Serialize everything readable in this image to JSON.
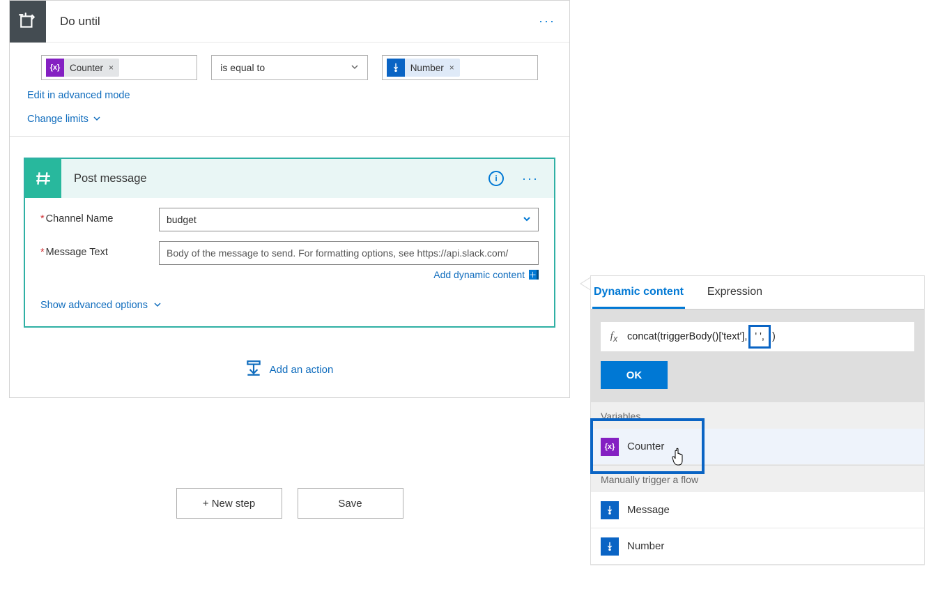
{
  "doUntil": {
    "title": "Do until",
    "leftToken": "Counter",
    "operator": "is equal to",
    "rightToken": "Number",
    "editAdvanced": "Edit in advanced mode",
    "changeLimits": "Change limits"
  },
  "postMessage": {
    "title": "Post message",
    "channelLabel": "Channel Name",
    "channelValue": "budget",
    "messageLabel": "Message Text",
    "messagePlaceholder": "Body of the message to send. For formatting options, see https://api.slack.com/",
    "addDynamic": "Add dynamic content",
    "showAdvanced": "Show advanced options"
  },
  "addAction": "Add an action",
  "footer": {
    "newStep": "+ New step",
    "save": "Save"
  },
  "dynPanel": {
    "tabDynamic": "Dynamic content",
    "tabExpression": "Expression",
    "exprPrefix": "concat(triggerBody()['text'],",
    "exprHighlight": "' ',",
    "exprSuffix": ")",
    "ok": "OK",
    "groupVariables": "Variables",
    "counter": "Counter",
    "groupTrigger": "Manually trigger a flow",
    "message": "Message",
    "number": "Number"
  }
}
